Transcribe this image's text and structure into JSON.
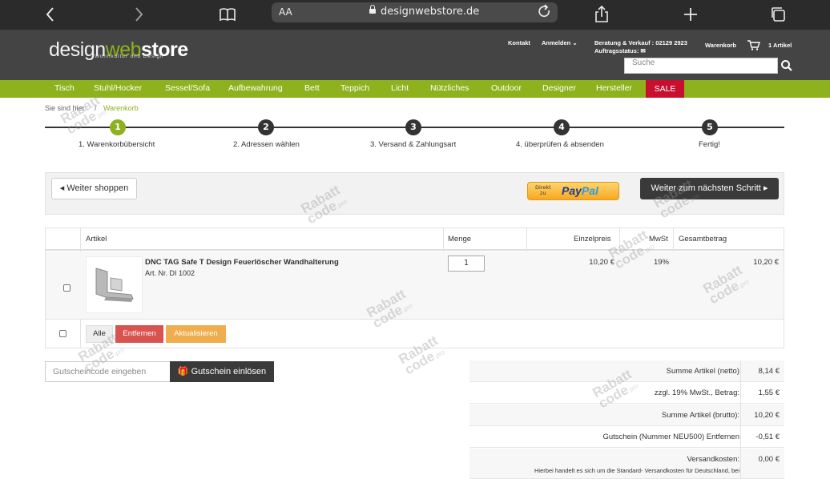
{
  "browser": {
    "aa_label": "AA",
    "domain": "designwebstore.de"
  },
  "header": {
    "logo": {
      "part1": "design",
      "part2": "web",
      "part3": "store",
      "tagline": "Wohnkultur und Design"
    },
    "contact": "Kontakt",
    "login": "Anmelden",
    "advice": "Beratung & Verkauf : 02129 2923",
    "order_status": "Auftragsstatus:",
    "cart_label": "Warenkorb",
    "cart_count": "1 Artikel",
    "search_placeholder": "Suche"
  },
  "nav": {
    "items": [
      "Tisch",
      "Stuhl/Hocker",
      "Sessel/Sofa",
      "Aufbewahrung",
      "Bett",
      "Teppich",
      "Licht",
      "Nützliches",
      "Outdoor",
      "Designer",
      "Hersteller"
    ],
    "sale": "SALE"
  },
  "breadcrumb": {
    "prefix": "Sie sind hier:",
    "separator": "/",
    "current": "Warenkorb"
  },
  "steps": [
    {
      "num": "1",
      "label": "1. Warenkorbübersicht"
    },
    {
      "num": "2",
      "label": "2. Adressen wählen"
    },
    {
      "num": "3",
      "label": "3. Versand & Zahlungsart"
    },
    {
      "num": "4",
      "label": "4. überprüfen & absenden"
    },
    {
      "num": "5",
      "label": "Fertig!"
    }
  ],
  "actions": {
    "continue_shopping": "Weiter shoppen",
    "paypal_small_1": "Direkt",
    "paypal_small_2": "zu",
    "paypal_logo_a": "Pay",
    "paypal_logo_b": "Pal",
    "next_step": "Weiter zum nächsten Schritt"
  },
  "table": {
    "headers": {
      "article": "Artikel",
      "qty": "Menge",
      "unit_price": "Einzelpreis",
      "vat": "MwSt",
      "total": "Gesamtbetrag"
    },
    "rows": [
      {
        "name": "DNC TAG Safe T Design Feuerlöscher Wandhalterung",
        "art_nr": "Art. Nr. DI 1002",
        "qty": "1",
        "unit_price": "10,20 €",
        "vat": "19%",
        "total": "10,20 €"
      }
    ],
    "footer": {
      "all": "Alle",
      "remove": "Entfernen",
      "update": "Aktualisieren"
    }
  },
  "coupon": {
    "placeholder": "Gutscheincode eingeben",
    "button": "Gutschein einlösen"
  },
  "summary": [
    {
      "label": "Summe Artikel (netto)",
      "value": "8,14 €"
    },
    {
      "label": "zzgl. 19% MwSt., Betrag:",
      "value": "1,55 €"
    },
    {
      "label": "Summe Artikel (brutto):",
      "value": "10,20 €"
    },
    {
      "label": "Gutschein (Nummer NEU500) Entfernen",
      "value": "-0,51 €"
    },
    {
      "label": "Versandkosten:",
      "value": "0,00 €",
      "note": "Hierbei handelt es sich um die Standard- Versandkosten für Deutschland, bei"
    }
  ],
  "watermark": {
    "line1": "Rabatt",
    "line2": "code",
    "suffix": ".pro"
  },
  "colors": {
    "brand_green": "#8db21d",
    "sale_red": "#c8102e",
    "header_dark": "#444444"
  }
}
